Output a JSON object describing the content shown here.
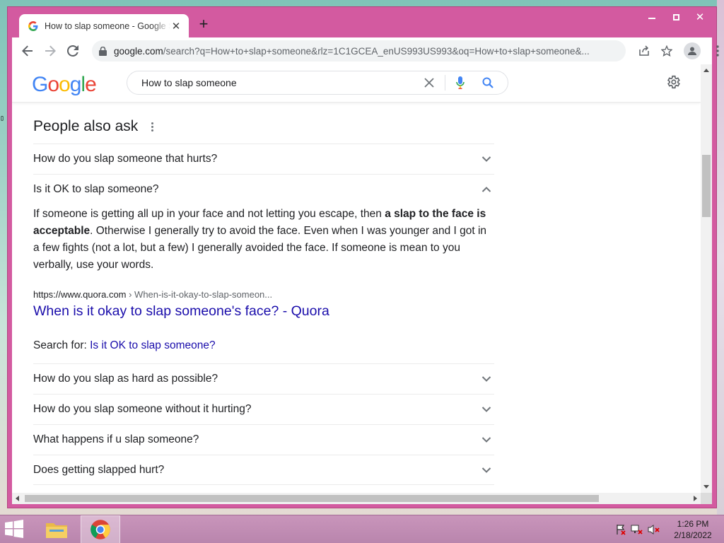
{
  "browser": {
    "tab_title": "How to slap someone - Google Search",
    "new_tab_symbol": "+",
    "tab_close_symbol": "✕",
    "url_host": "google.com",
    "url_rest": "/search?q=How+to+slap+someone&rlz=1C1GCEA_enUS993US993&oq=How+to+slap+someone&..."
  },
  "google": {
    "logo": [
      "G",
      "o",
      "o",
      "g",
      "l",
      "e"
    ],
    "search_query": "How to slap someone"
  },
  "paa": {
    "title": "People also ask",
    "questions_top": [
      {
        "text": "How do you slap someone that hurts?",
        "expanded": false
      },
      {
        "text": "Is it OK to slap someone?",
        "expanded": true
      }
    ],
    "answer": {
      "part1": "If someone is getting all up in your face and not letting you escape, then ",
      "bold": "a slap to the face is acceptable",
      "part2": ". Otherwise I generally try to avoid the face. Even when I was younger and I got in a few fights (not a lot, but a few) I generally avoided the face. If someone is mean to you verbally, use your words."
    },
    "source": {
      "url": "https://www.quora.com",
      "breadcrumb": " › When-is-it-okay-to-slap-someon...",
      "title": "When is it okay to slap someone's face? - Quora"
    },
    "search_for_label": "Search for: ",
    "search_for_link": "Is it OK to slap someone?",
    "questions_bottom": [
      {
        "text": "How do you slap as hard as possible?"
      },
      {
        "text": "How do you slap someone without it hurting?"
      },
      {
        "text": "What happens if u slap someone?"
      },
      {
        "text": "Does getting slapped hurt?"
      }
    ]
  },
  "taskbar": {
    "time": "1:26 PM",
    "date": "2/18/2022"
  },
  "colors": {
    "window_frame": "#d35aa0",
    "link": "#1a0dab",
    "taskbar": "#c995bb"
  }
}
